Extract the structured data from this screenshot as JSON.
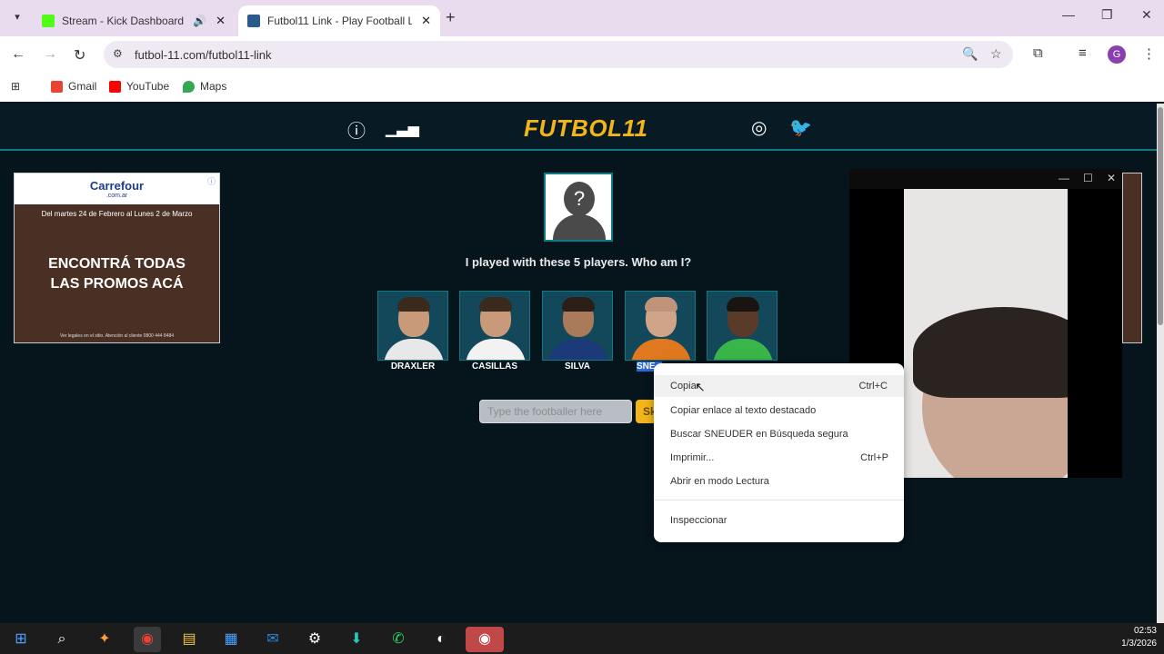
{
  "browser": {
    "tabs": [
      {
        "title": "Stream - Kick Dashboard",
        "favicon_color": "#53fc18",
        "active": false
      },
      {
        "title": "Futbol11 Link - Play Football Li",
        "favicon_color": "#2a5a8a",
        "active": true
      }
    ],
    "url": "futbol-11.com/futbol11-link",
    "bookmarks": [
      {
        "label": "Gmail",
        "icon": "gmail-icon"
      },
      {
        "label": "YouTube",
        "icon": "youtube-icon"
      },
      {
        "label": "Maps",
        "icon": "maps-icon"
      }
    ]
  },
  "site": {
    "logo": "FUTBOL11",
    "question": "I played with these 5 players. Who am I?",
    "players": [
      {
        "name": "DRAXLER",
        "selected": false
      },
      {
        "name": "CASILLAS",
        "selected": false
      },
      {
        "name": "SILVA",
        "selected": false
      },
      {
        "name": "SNE",
        "selected": true
      },
      {
        "name": "",
        "selected": false
      }
    ],
    "input_placeholder": "Type the footballer here",
    "skip_label": "Sk"
  },
  "ad": {
    "brand": "Carrefour",
    "domain": ".com.ar",
    "dates": "Del martes 24 de Febrero al Lunes 2 de Marzo",
    "headline_1": "ENCONTRÁ TODAS",
    "headline_2": "LAS PROMOS ACÁ",
    "footer": "Ver legales en el sitio. Atención al cliente 0800 444 8484"
  },
  "context_menu": {
    "items": [
      {
        "label": "Copiar",
        "shortcut": "Ctrl+C"
      },
      {
        "label": "Copiar enlace al texto destacado",
        "shortcut": ""
      },
      {
        "label": "Buscar SNEUDER en Búsqueda segura",
        "shortcut": ""
      },
      {
        "label": "Imprimir...",
        "shortcut": "Ctrl+P"
      },
      {
        "label": "Abrir en modo Lectura",
        "shortcut": ""
      },
      {
        "label": "Inspeccionar",
        "shortcut": ""
      }
    ]
  },
  "taskbar": {
    "time": "02:53",
    "date": "1/3/2026"
  }
}
